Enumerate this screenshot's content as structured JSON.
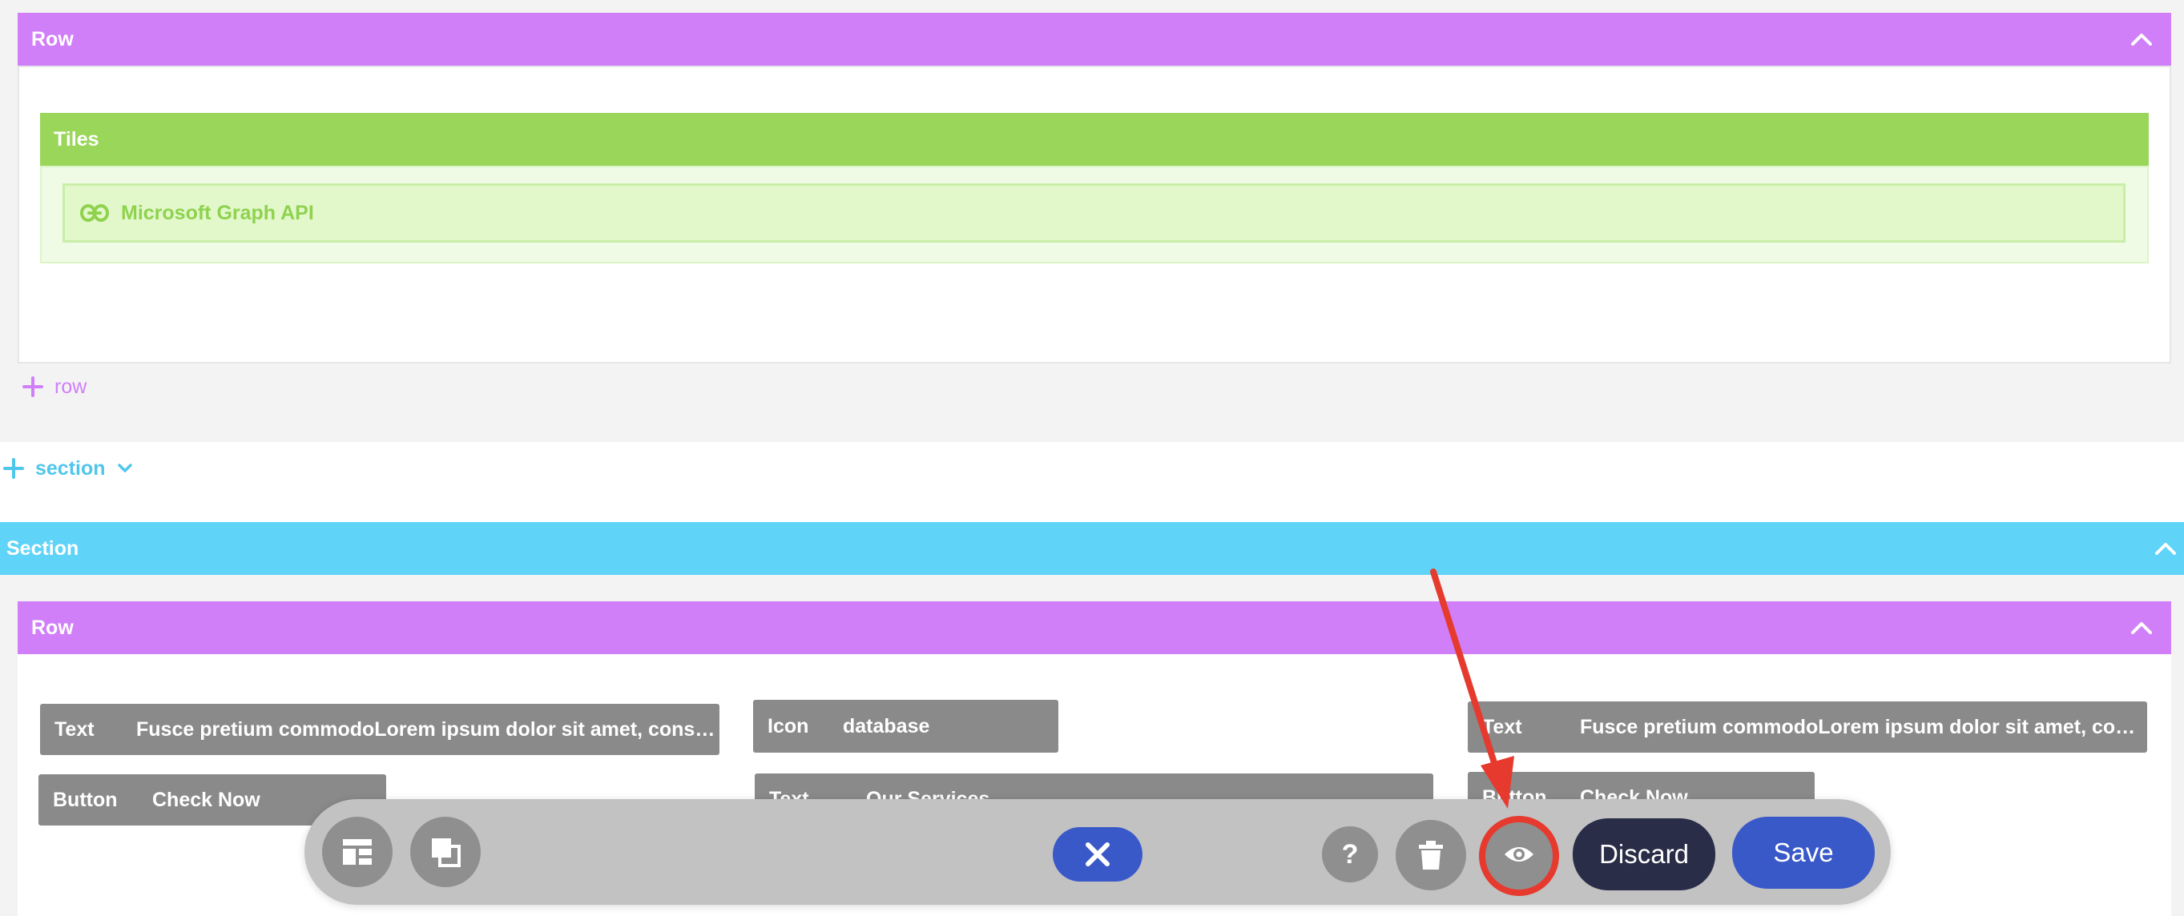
{
  "rows": [
    {
      "header": "Row"
    },
    {
      "header": "Row"
    }
  ],
  "tiles": {
    "header": "Tiles",
    "item_label": "Microsoft Graph API",
    "item_icon": "link-icon"
  },
  "add_row_label": "row",
  "add_section_label": "section",
  "section_header": "Section",
  "widgets": [
    {
      "type": "Text",
      "value": "Fusce pretium commodoLorem ipsum dolor sit amet, conse..."
    },
    {
      "type": "Button",
      "value": "Check Now"
    },
    {
      "type": "Icon",
      "value": "database"
    },
    {
      "type": "Text",
      "value": "Our Services"
    },
    {
      "type": "Text",
      "value": "Fusce pretium commodoLorem ipsum dolor sit amet, conse..."
    },
    {
      "type": "Button",
      "value": "Check Now"
    }
  ],
  "toolbar": {
    "discard_label": "Discard",
    "save_label": "Save",
    "help_label": "?"
  },
  "colors": {
    "row": "#d07ff9",
    "section": "#5fd4f8",
    "tiles": "#9ad65a",
    "save": "#3a59c9",
    "discard": "#2a2d47",
    "annotation": "#e63a2e"
  }
}
